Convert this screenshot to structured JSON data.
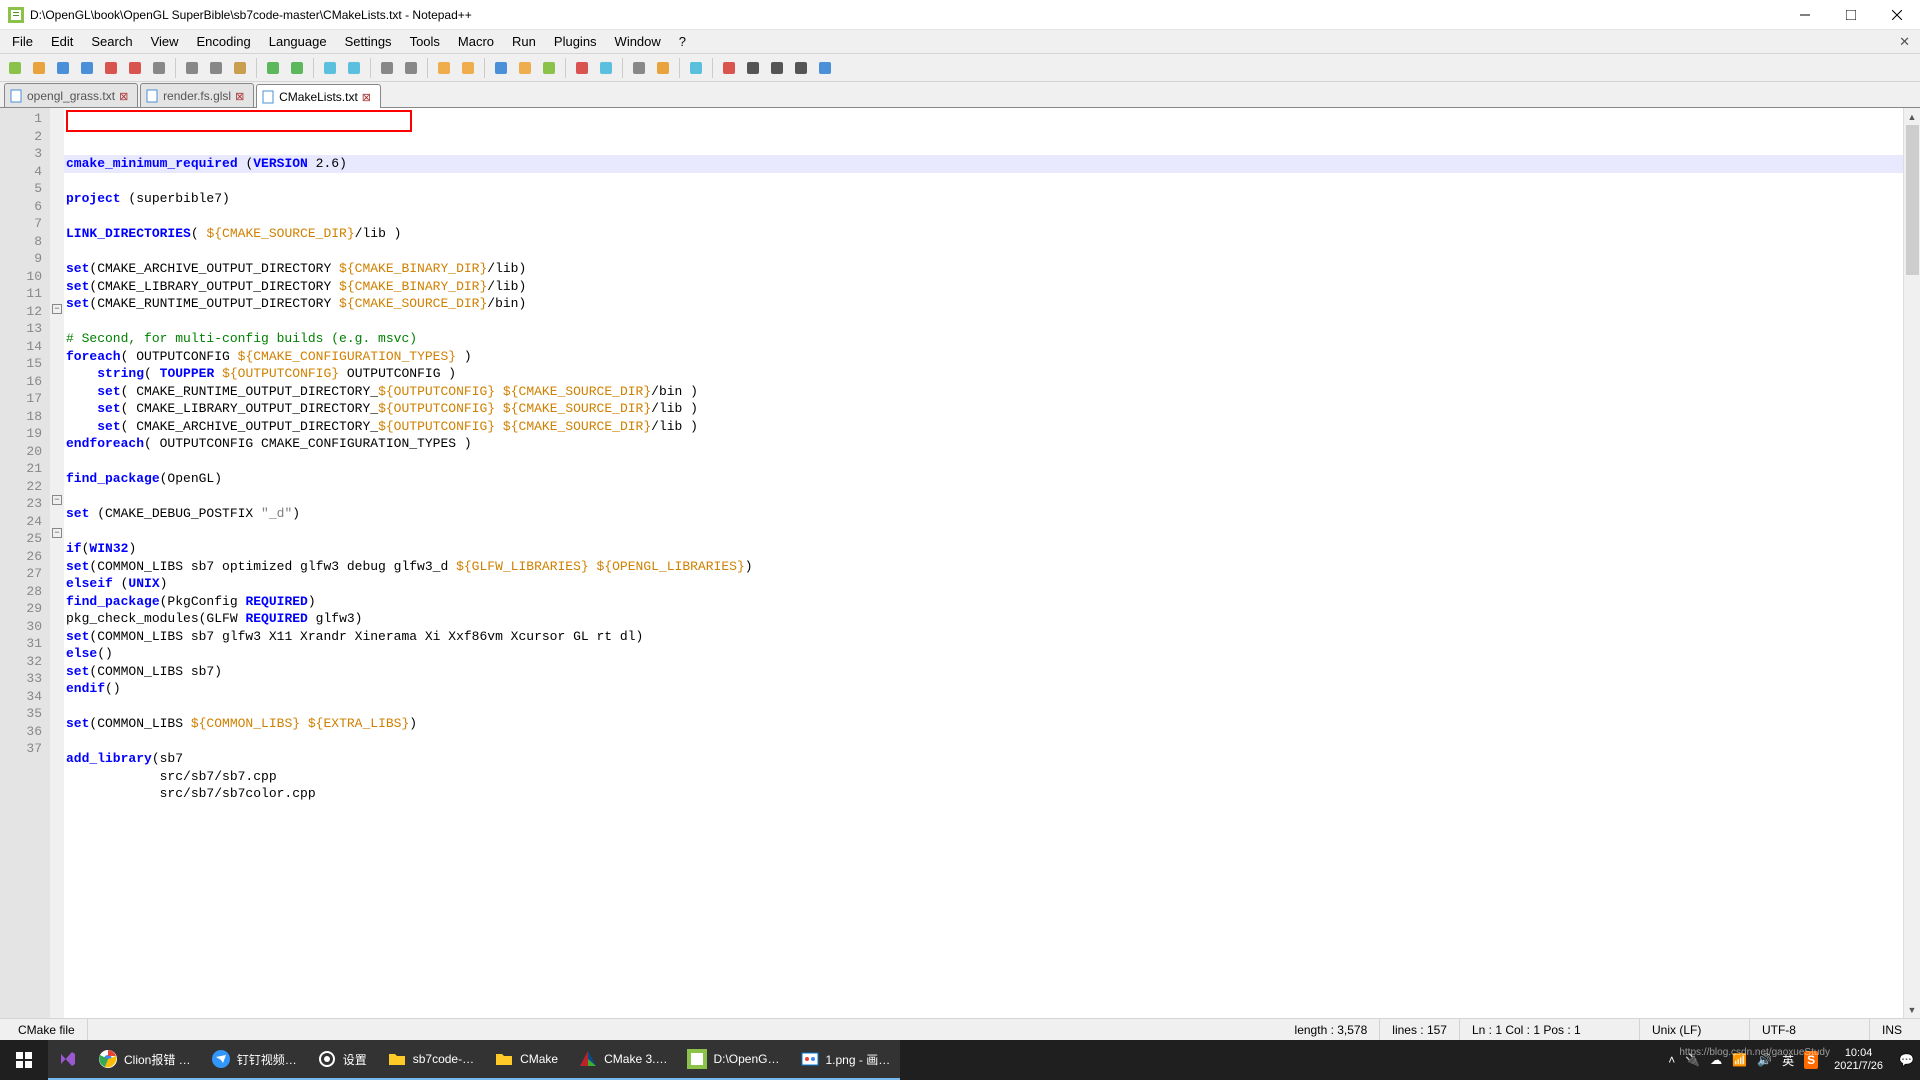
{
  "window": {
    "title": "D:\\OpenGL\\book\\OpenGL SuperBible\\sb7code-master\\CMakeLists.txt - Notepad++"
  },
  "menu": {
    "items": [
      "File",
      "Edit",
      "Search",
      "View",
      "Encoding",
      "Language",
      "Settings",
      "Tools",
      "Macro",
      "Run",
      "Plugins",
      "Window",
      "?"
    ]
  },
  "tabs": [
    {
      "label": "opengl_grass.txt",
      "active": false
    },
    {
      "label": "render.fs.glsl",
      "active": false
    },
    {
      "label": "CMakeLists.txt",
      "active": true
    }
  ],
  "code_lines": [
    [
      [
        "kw",
        "cmake_minimum_required"
      ],
      [
        "",
        " ("
      ],
      [
        "kw",
        "VERSION"
      ],
      [
        "",
        " 2.6)"
      ]
    ],
    [],
    [
      [
        "kw",
        "project"
      ],
      [
        "",
        " (superbible7)"
      ]
    ],
    [],
    [
      [
        "kw",
        "LINK_DIRECTORIES"
      ],
      [
        "",
        "( "
      ],
      [
        "var",
        "${CMAKE_SOURCE_DIR}"
      ],
      [
        "",
        "/lib )"
      ]
    ],
    [],
    [
      [
        "kw",
        "set"
      ],
      [
        "",
        "(CMAKE_ARCHIVE_OUTPUT_DIRECTORY "
      ],
      [
        "var",
        "${CMAKE_BINARY_DIR}"
      ],
      [
        "",
        "/lib)"
      ]
    ],
    [
      [
        "kw",
        "set"
      ],
      [
        "",
        "(CMAKE_LIBRARY_OUTPUT_DIRECTORY "
      ],
      [
        "var",
        "${CMAKE_BINARY_DIR}"
      ],
      [
        "",
        "/lib)"
      ]
    ],
    [
      [
        "kw",
        "set"
      ],
      [
        "",
        "(CMAKE_RUNTIME_OUTPUT_DIRECTORY "
      ],
      [
        "var",
        "${CMAKE_SOURCE_DIR}"
      ],
      [
        "",
        "/bin)"
      ]
    ],
    [],
    [
      [
        "cmt",
        "# Second, for multi-config builds (e.g. msvc)"
      ]
    ],
    [
      [
        "kw",
        "foreach"
      ],
      [
        "",
        "( OUTPUTCONFIG "
      ],
      [
        "var",
        "${CMAKE_CONFIGURATION_TYPES}"
      ],
      [
        "",
        " )"
      ]
    ],
    [
      [
        "",
        "    "
      ],
      [
        "kw",
        "string"
      ],
      [
        "",
        "( "
      ],
      [
        "kw",
        "TOUPPER"
      ],
      [
        "",
        " "
      ],
      [
        "var",
        "${OUTPUTCONFIG}"
      ],
      [
        "",
        " OUTPUTCONFIG )"
      ]
    ],
    [
      [
        "",
        "    "
      ],
      [
        "kw",
        "set"
      ],
      [
        "",
        "( CMAKE_RUNTIME_OUTPUT_DIRECTORY_"
      ],
      [
        "var",
        "${OUTPUTCONFIG}"
      ],
      [
        "",
        " "
      ],
      [
        "var",
        "${CMAKE_SOURCE_DIR}"
      ],
      [
        "",
        "/bin )"
      ]
    ],
    [
      [
        "",
        "    "
      ],
      [
        "kw",
        "set"
      ],
      [
        "",
        "( CMAKE_LIBRARY_OUTPUT_DIRECTORY_"
      ],
      [
        "var",
        "${OUTPUTCONFIG}"
      ],
      [
        "",
        " "
      ],
      [
        "var",
        "${CMAKE_SOURCE_DIR}"
      ],
      [
        "",
        "/lib )"
      ]
    ],
    [
      [
        "",
        "    "
      ],
      [
        "kw",
        "set"
      ],
      [
        "",
        "( CMAKE_ARCHIVE_OUTPUT_DIRECTORY_"
      ],
      [
        "var",
        "${OUTPUTCONFIG}"
      ],
      [
        "",
        " "
      ],
      [
        "var",
        "${CMAKE_SOURCE_DIR}"
      ],
      [
        "",
        "/lib )"
      ]
    ],
    [
      [
        "kw",
        "endforeach"
      ],
      [
        "",
        "( OUTPUTCONFIG CMAKE_CONFIGURATION_TYPES )"
      ]
    ],
    [],
    [
      [
        "kw",
        "find_package"
      ],
      [
        "",
        "(OpenGL)"
      ]
    ],
    [],
    [
      [
        "kw",
        "set"
      ],
      [
        "",
        " (CMAKE_DEBUG_POSTFIX "
      ],
      [
        "str",
        "\"_d\""
      ],
      [
        "",
        ")"
      ]
    ],
    [],
    [
      [
        "kw",
        "if"
      ],
      [
        "",
        "("
      ],
      [
        "kw",
        "WIN32"
      ],
      [
        "",
        ")"
      ]
    ],
    [
      [
        "kw",
        "set"
      ],
      [
        "",
        "(COMMON_LIBS sb7 optimized glfw3 debug glfw3_d "
      ],
      [
        "var",
        "${GLFW_LIBRARIES}"
      ],
      [
        "",
        " "
      ],
      [
        "var",
        "${OPENGL_LIBRARIES}"
      ],
      [
        "",
        ")"
      ]
    ],
    [
      [
        "kw",
        "elseif"
      ],
      [
        "",
        " ("
      ],
      [
        "kw",
        "UNIX"
      ],
      [
        "",
        ")"
      ]
    ],
    [
      [
        "kw",
        "find_package"
      ],
      [
        "",
        "(PkgConfig "
      ],
      [
        "kw",
        "REQUIRED"
      ],
      [
        "",
        ")"
      ]
    ],
    [
      [
        "",
        "pkg_check_modules(GLFW "
      ],
      [
        "kw",
        "REQUIRED"
      ],
      [
        "",
        " glfw3)"
      ]
    ],
    [
      [
        "kw",
        "set"
      ],
      [
        "",
        "(COMMON_LIBS sb7 glfw3 X11 Xrandr Xinerama Xi Xxf86vm Xcursor GL rt dl)"
      ]
    ],
    [
      [
        "kw",
        "else"
      ],
      [
        "",
        "()"
      ]
    ],
    [
      [
        "kw",
        "set"
      ],
      [
        "",
        "(COMMON_LIBS sb7)"
      ]
    ],
    [
      [
        "kw",
        "endif"
      ],
      [
        "",
        "()"
      ]
    ],
    [],
    [
      [
        "kw",
        "set"
      ],
      [
        "",
        "(COMMON_LIBS "
      ],
      [
        "var",
        "${COMMON_LIBS}"
      ],
      [
        "",
        " "
      ],
      [
        "var",
        "${EXTRA_LIBS}"
      ],
      [
        "",
        ")"
      ]
    ],
    [],
    [
      [
        "kw",
        "add_library"
      ],
      [
        "",
        "(sb7"
      ]
    ],
    [
      [
        "",
        "            src/sb7/sb7.cpp"
      ]
    ],
    [
      [
        "",
        "            src/sb7/sb7color.cpp"
      ]
    ]
  ],
  "fold_marks": {
    "12": "-",
    "17": "end",
    "23": "-",
    "25": "-",
    "31": "end"
  },
  "status": {
    "filetype": "CMake file",
    "length": "length : 3,578",
    "lines": "lines : 157",
    "pos": "Ln : 1   Col : 1   Pos : 1",
    "eol": "Unix (LF)",
    "enc": "UTF-8",
    "mode": "INS"
  },
  "taskbar": {
    "tasks": [
      {
        "label": "",
        "icon": "vs",
        "color": "#9b59d0"
      },
      {
        "label": "Clion报错 …",
        "icon": "chrome"
      },
      {
        "label": "钉钉视频…",
        "icon": "dingtalk"
      },
      {
        "label": "设置",
        "icon": "gear"
      },
      {
        "label": "sb7code-…",
        "icon": "folder"
      },
      {
        "label": "CMake",
        "icon": "folder"
      },
      {
        "label": "CMake 3.…",
        "icon": "cmake"
      },
      {
        "label": "D:\\OpenG…",
        "icon": "npp"
      },
      {
        "label": "1.png - 画…",
        "icon": "paint"
      }
    ],
    "ime": "英",
    "clock_time": "10:04",
    "clock_date": "2021/7/26",
    "watermark": "https://blog.csdn.net/gaoxueStudy"
  },
  "toolbar_icons": [
    "new-icon",
    "open-icon",
    "save-icon",
    "save-all-icon",
    "close-icon",
    "close-all-icon",
    "print-icon",
    "sep",
    "cut-icon",
    "copy-icon",
    "paste-icon",
    "sep",
    "undo-icon",
    "redo-icon",
    "sep",
    "find-icon",
    "replace-icon",
    "sep",
    "zoom-in-icon",
    "zoom-out-icon",
    "sep",
    "sync-v-icon",
    "sync-h-icon",
    "sep",
    "wrap-icon",
    "all-chars-icon",
    "indent-guide-icon",
    "sep",
    "lang-icon",
    "doc-map-icon",
    "sep",
    "func-list-icon",
    "folder-icon",
    "sep",
    "monitor-icon",
    "sep",
    "record-icon",
    "stop-icon",
    "play-icon",
    "play-multi-icon",
    "save-macro-icon"
  ]
}
